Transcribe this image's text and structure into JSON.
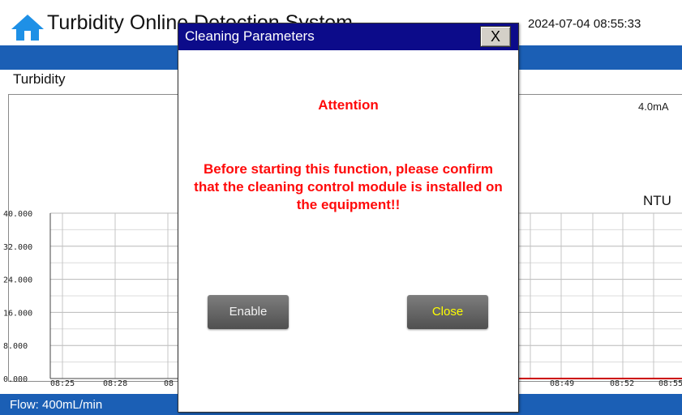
{
  "header": {
    "title": "Turbidity Online Detection System",
    "datetime": "2024-07-04 08:55:33"
  },
  "section": {
    "label": "Turbidity"
  },
  "readings": {
    "current": "4.0mA",
    "unit": "NTU"
  },
  "footer": {
    "flow": "Flow:  400mL/min"
  },
  "icons": {
    "home": "home-icon"
  },
  "colors": {
    "accent_blue": "#1b5fb5",
    "dialog_title": "#0c0b8a",
    "warning_red": "#ff0a0a",
    "trend_line": "#cc0000"
  },
  "dialog": {
    "title": "Cleaning Parameters",
    "close_x": "X",
    "attention": "Attention",
    "message": "Before starting this function, please confirm that the cleaning control module is installed on the equipment!!",
    "enable_label": "Enable",
    "close_label": "Close"
  },
  "chart_data": {
    "type": "line",
    "y_ticks": [
      "40.000",
      "32.000",
      "24.000",
      "16.000",
      "8.000",
      "0.000"
    ],
    "x_ticks": [
      "08:25",
      "08:28",
      "08",
      "08:49",
      "08:52",
      "08:55"
    ],
    "ylim": [
      0,
      40
    ],
    "grid": true,
    "series": [
      {
        "values": [
          0,
          0,
          0,
          0,
          0,
          0
        ]
      }
    ]
  }
}
